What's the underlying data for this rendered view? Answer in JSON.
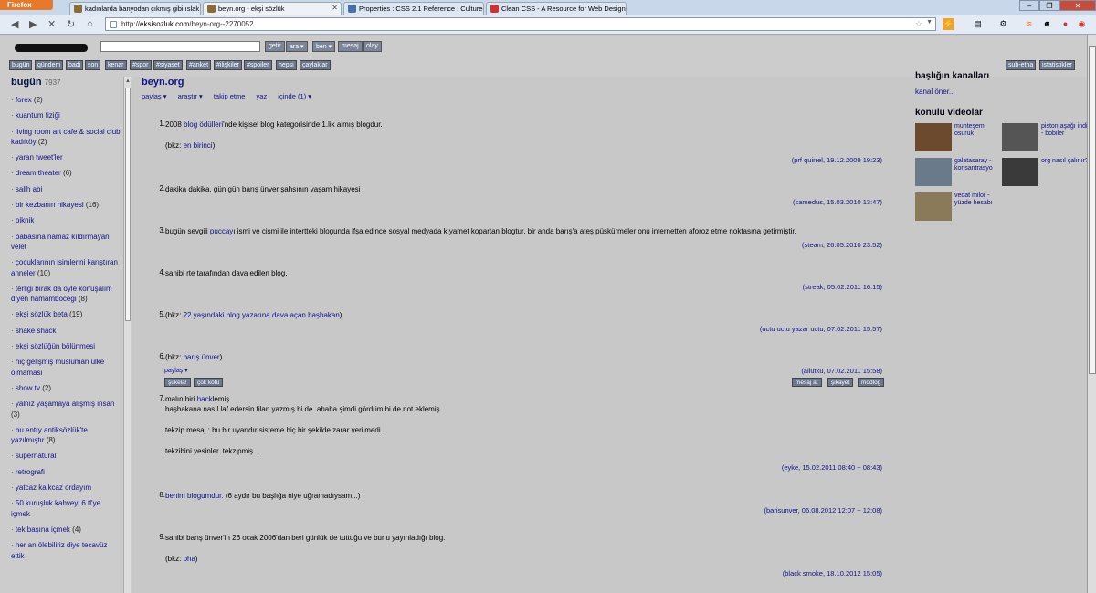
{
  "browser": {
    "app_button": "Firefox",
    "tabs": [
      {
        "label": "kadınlarda banyodan çıkmış gibi ıslak sa...",
        "active": false
      },
      {
        "label": "beyn.org - ekşi sözlük",
        "active": true
      },
      {
        "label": "Properties : CSS 2.1 Reference : Cultured ...",
        "active": false
      },
      {
        "label": "Clean CSS - A Resource for Web Designe...",
        "active": false
      }
    ],
    "url_prefix": "http://",
    "url_host": "eksisozluk.com",
    "url_path": "/beyn-org--2270052"
  },
  "header": {
    "logo": "ekşi sözlük",
    "search_buttons": [
      "getir",
      "ara ▾",
      "ben ▾",
      "mesaj",
      "olay"
    ],
    "categories": [
      "bugün",
      "gündem",
      "badi",
      "son",
      "kenar",
      "#spor",
      "#siyaset",
      "#anket",
      "#ilişkiler",
      "#spoiler",
      "hepsi",
      "çaylaklar"
    ],
    "right_buttons": [
      "sub-etha",
      "istatistikler"
    ]
  },
  "sidebar": {
    "title": "bugün",
    "count": "7937",
    "items": [
      {
        "label": "forex",
        "count": "(2)"
      },
      {
        "label": "kuantum fiziği",
        "count": ""
      },
      {
        "label": "living room art cafe & social club kadıköy",
        "count": "(2)"
      },
      {
        "label": "yaran tweet'ler",
        "count": ""
      },
      {
        "label": "dream theater",
        "count": "(6)"
      },
      {
        "label": "salih abi",
        "count": ""
      },
      {
        "label": "bir kezbanın hikayesi",
        "count": "(16)"
      },
      {
        "label": "piknik",
        "count": ""
      },
      {
        "label": "babasına namaz kıldırmayan velet",
        "count": ""
      },
      {
        "label": "çocuklarının isimlerini karıştıran anneler",
        "count": "(10)"
      },
      {
        "label": "terliği bırak da öyle konuşalım diyen hamamböceği",
        "count": "(8)"
      },
      {
        "label": "ekşi sözlük beta",
        "count": "(19)"
      },
      {
        "label": "shake shack",
        "count": ""
      },
      {
        "label": "ekşi sözlüğün bölünmesi",
        "count": ""
      },
      {
        "label": "hiç gelişmiş müslüman ülke olmaması",
        "count": ""
      },
      {
        "label": "show tv",
        "count": "(2)"
      },
      {
        "label": "yalnız yaşamaya alışmış insan",
        "count": "(3)"
      },
      {
        "label": "bu entry antiksözlük'te yazılmıştır",
        "count": "(8)"
      },
      {
        "label": "supernatural",
        "count": ""
      },
      {
        "label": "retrografi",
        "count": ""
      },
      {
        "label": "yatcaz kalkcaz ordayım",
        "count": ""
      },
      {
        "label": "50 kuruşluk kahveyi 6 tl'ye içmek",
        "count": ""
      },
      {
        "label": "tek başına içmek",
        "count": "(4)"
      },
      {
        "label": "her an ölebiliriz diye tecavüz ettik",
        "count": ""
      }
    ]
  },
  "main": {
    "title": "beyn.org",
    "subnav": [
      "paylaş ▾",
      "araştır ▾",
      "takip etme",
      "yaz",
      "içinde (1) ▾"
    ],
    "entries": [
      {
        "num": "1.",
        "author": "(prf quirrel, 19.12.2009 19:23)"
      },
      {
        "num": "2.",
        "author": "(samedus, 15.03.2010 13:47)"
      },
      {
        "num": "3.",
        "author": "(steam, 26.05.2010 23:52)"
      },
      {
        "num": "4.",
        "author": "(streak, 05.02.2011 16:15)"
      },
      {
        "num": "5.",
        "author": "(uctu uctu yazar uctu, 07.02.2011 15:57)"
      },
      {
        "num": "6.",
        "author": "(aliutku, 07.02.2011 15:58)"
      },
      {
        "num": "7.",
        "author": "(eyke, 15.02.2011 08:40 ~ 08:43)"
      },
      {
        "num": "8.",
        "author": "(barisunver, 06.08.2012 12:07 ~ 12:08)"
      },
      {
        "num": "9.",
        "author": "(black smoke, 18.10.2012 15:05)"
      }
    ],
    "e1": {
      "t1": "2008 ",
      "l1": "blog ödülleri",
      "t2": "'nde kişisel blog kategorisinde 1.lik almış blogdur.",
      "bkz": "(bkz: ",
      "l2": "en birinci",
      "close": ")"
    },
    "e2": {
      "t1": "dakika dakika, gün gün barış ünver şahsının yaşam hikayesi"
    },
    "e3": {
      "t1": "bugün sevgili ",
      "l1": "puccay",
      "t2": "ı ismi ve cismi ile intertteki blogunda ifşa edince sosyal medyada kıyamet kopartan blogtur. bir anda barış'a ateş püskürmeler onu internetten aforoz etme noktasına getirmiştir."
    },
    "e4": {
      "t1": "sahibi rte tarafından dava edilen blog."
    },
    "e5": {
      "t1": "(bkz: ",
      "l1": "22 yaşındaki blog yazarına dava açan başbakan",
      "t2": ")"
    },
    "e6": {
      "t1": "(bkz: ",
      "l1": "barış ünver",
      "t2": ")",
      "share": "paylaş ▾",
      "btn_left": [
        "şükela!",
        "çok kötü"
      ],
      "btn_right": [
        "mesaj at",
        "şikayet",
        "modlog"
      ]
    },
    "e7": {
      "t1": "malın biri ",
      "l1": "hack",
      "t2": "lemiş",
      "line2": "başbakana nasıl laf edersin filan yazmış bi de. ahaha şimdi gördüm bi de not eklemiş",
      "line3": "tekzip mesaj : bu bir uyarıdır sisteme hiç bir şekilde zarar verilmedi.",
      "line4": "tekzibini yesinler. tekzipmiş...."
    },
    "e8": {
      "l1": "benim blogumdur.",
      "t2": " (6 aydır bu başlığa niye uğramadıysam...)"
    },
    "e9": {
      "t1": "sahibi barış ünver'in 26 ocak 2006'dan beri günlük de tuttuğu ve bunu yayınladığı blog.",
      "bkz": "(bkz: ",
      "l1": "oha",
      "close": ")"
    }
  },
  "right": {
    "channels_title": "başlığın kanalları",
    "channels_link": "kanal öner...",
    "videos_title": "konulu videolar",
    "videos": [
      {
        "label": "muhteşem osuruk",
        "color": "#6b4a2e"
      },
      {
        "label": "piston aşağı indi - bobiler",
        "color": "#555"
      },
      {
        "label": "galatasaray - konsantrasyo",
        "color": "#6a7a8a"
      },
      {
        "label": "org nasıl çalınır?",
        "color": "#3a3a3a"
      },
      {
        "label": "vedat milor - yüzde hesabı",
        "color": "#8a7a5a"
      }
    ]
  }
}
